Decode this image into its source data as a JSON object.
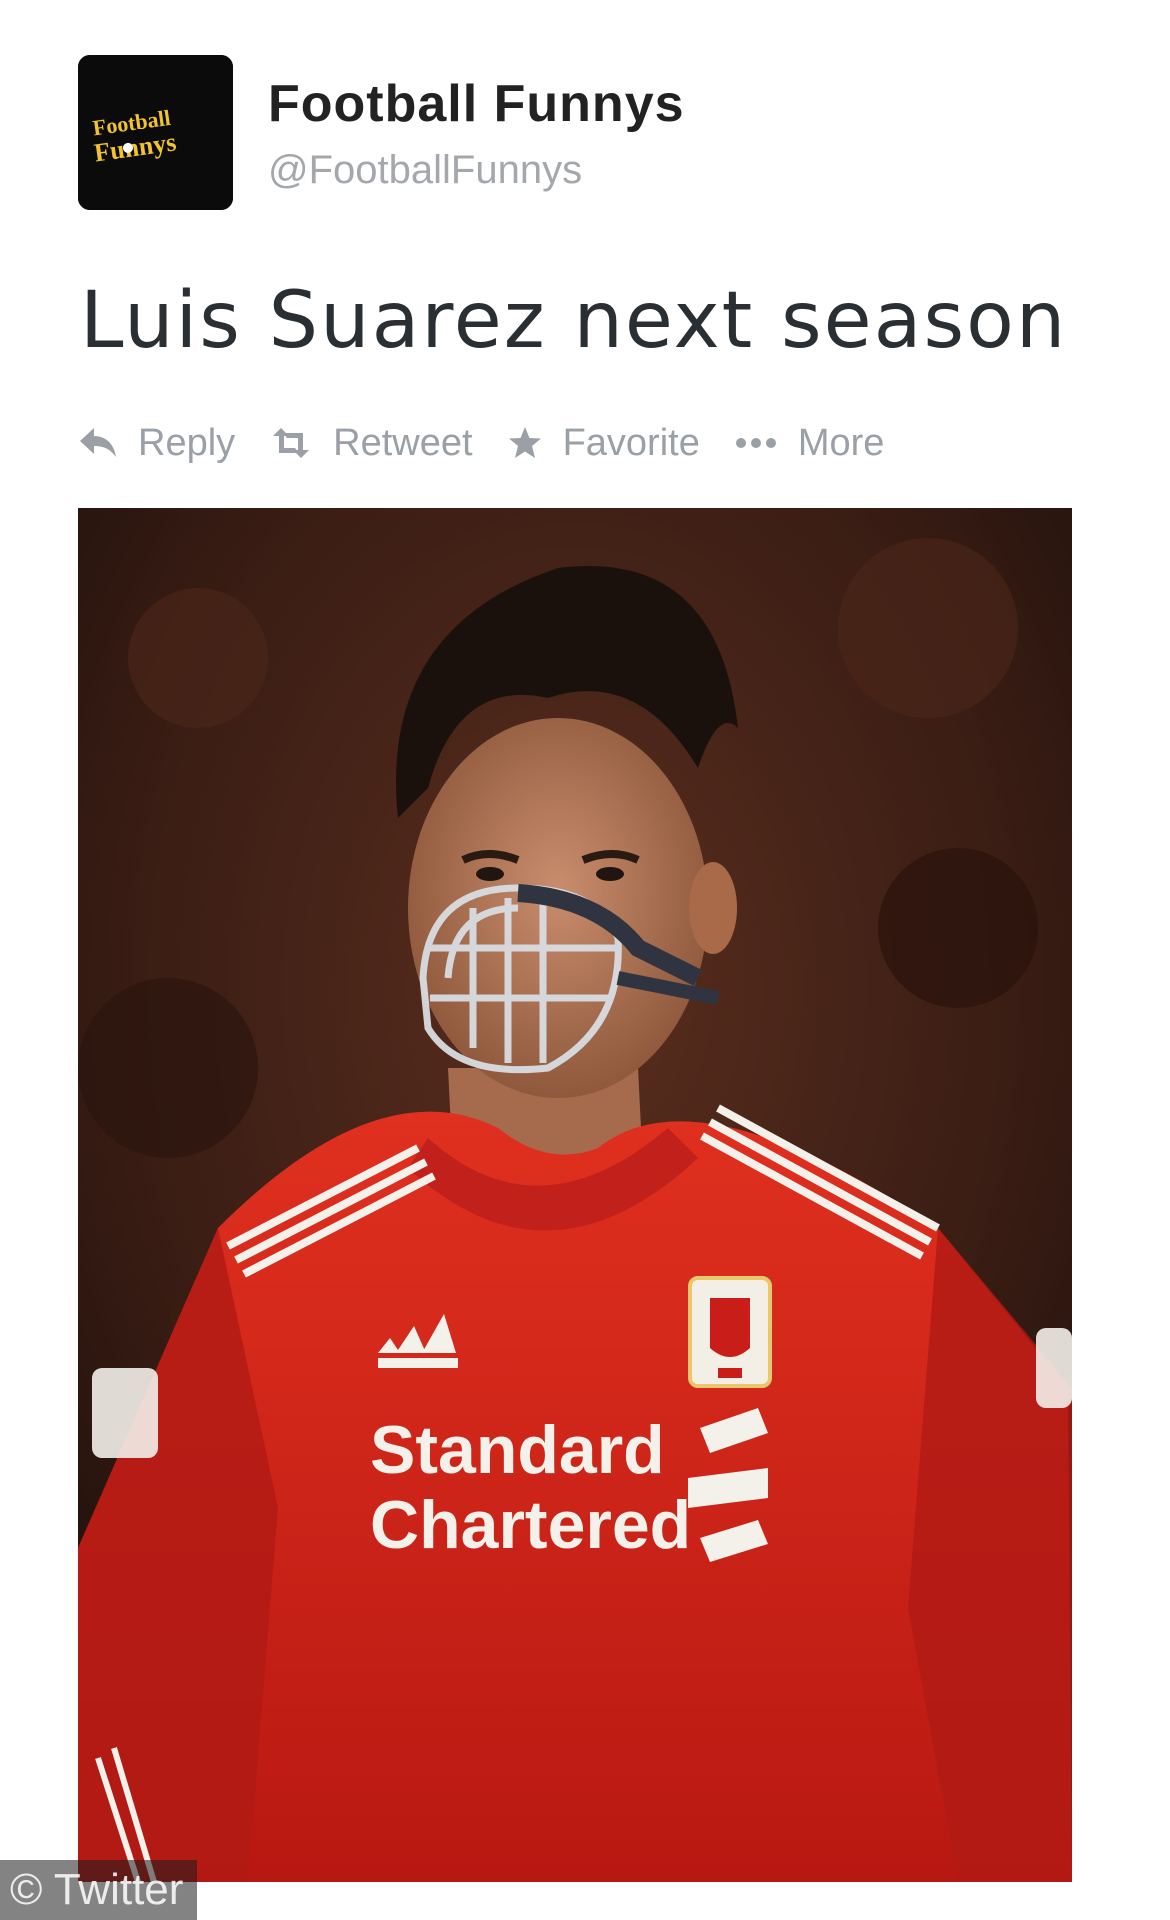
{
  "account": {
    "display_name": "Football Funnys",
    "handle": "@FootballFunnys",
    "avatar_text_top": "Football",
    "avatar_text_bottom": "Funnys"
  },
  "tweet": {
    "text": "Luis Suarez next season"
  },
  "actions": [
    {
      "label": "Reply",
      "icon": "reply-icon"
    },
    {
      "label": "Retweet",
      "icon": "retweet-icon"
    },
    {
      "label": "Favorite",
      "icon": "star-icon"
    },
    {
      "label": "More",
      "icon": "more-dots-icon"
    }
  ],
  "photo": {
    "sponsor_line_1": "Standard",
    "sponsor_line_2": "Chartered"
  },
  "credit": "© Twitter",
  "colors": {
    "text": "#292f33",
    "muted": "#9aa0a5",
    "jersey": "#d7261e"
  }
}
